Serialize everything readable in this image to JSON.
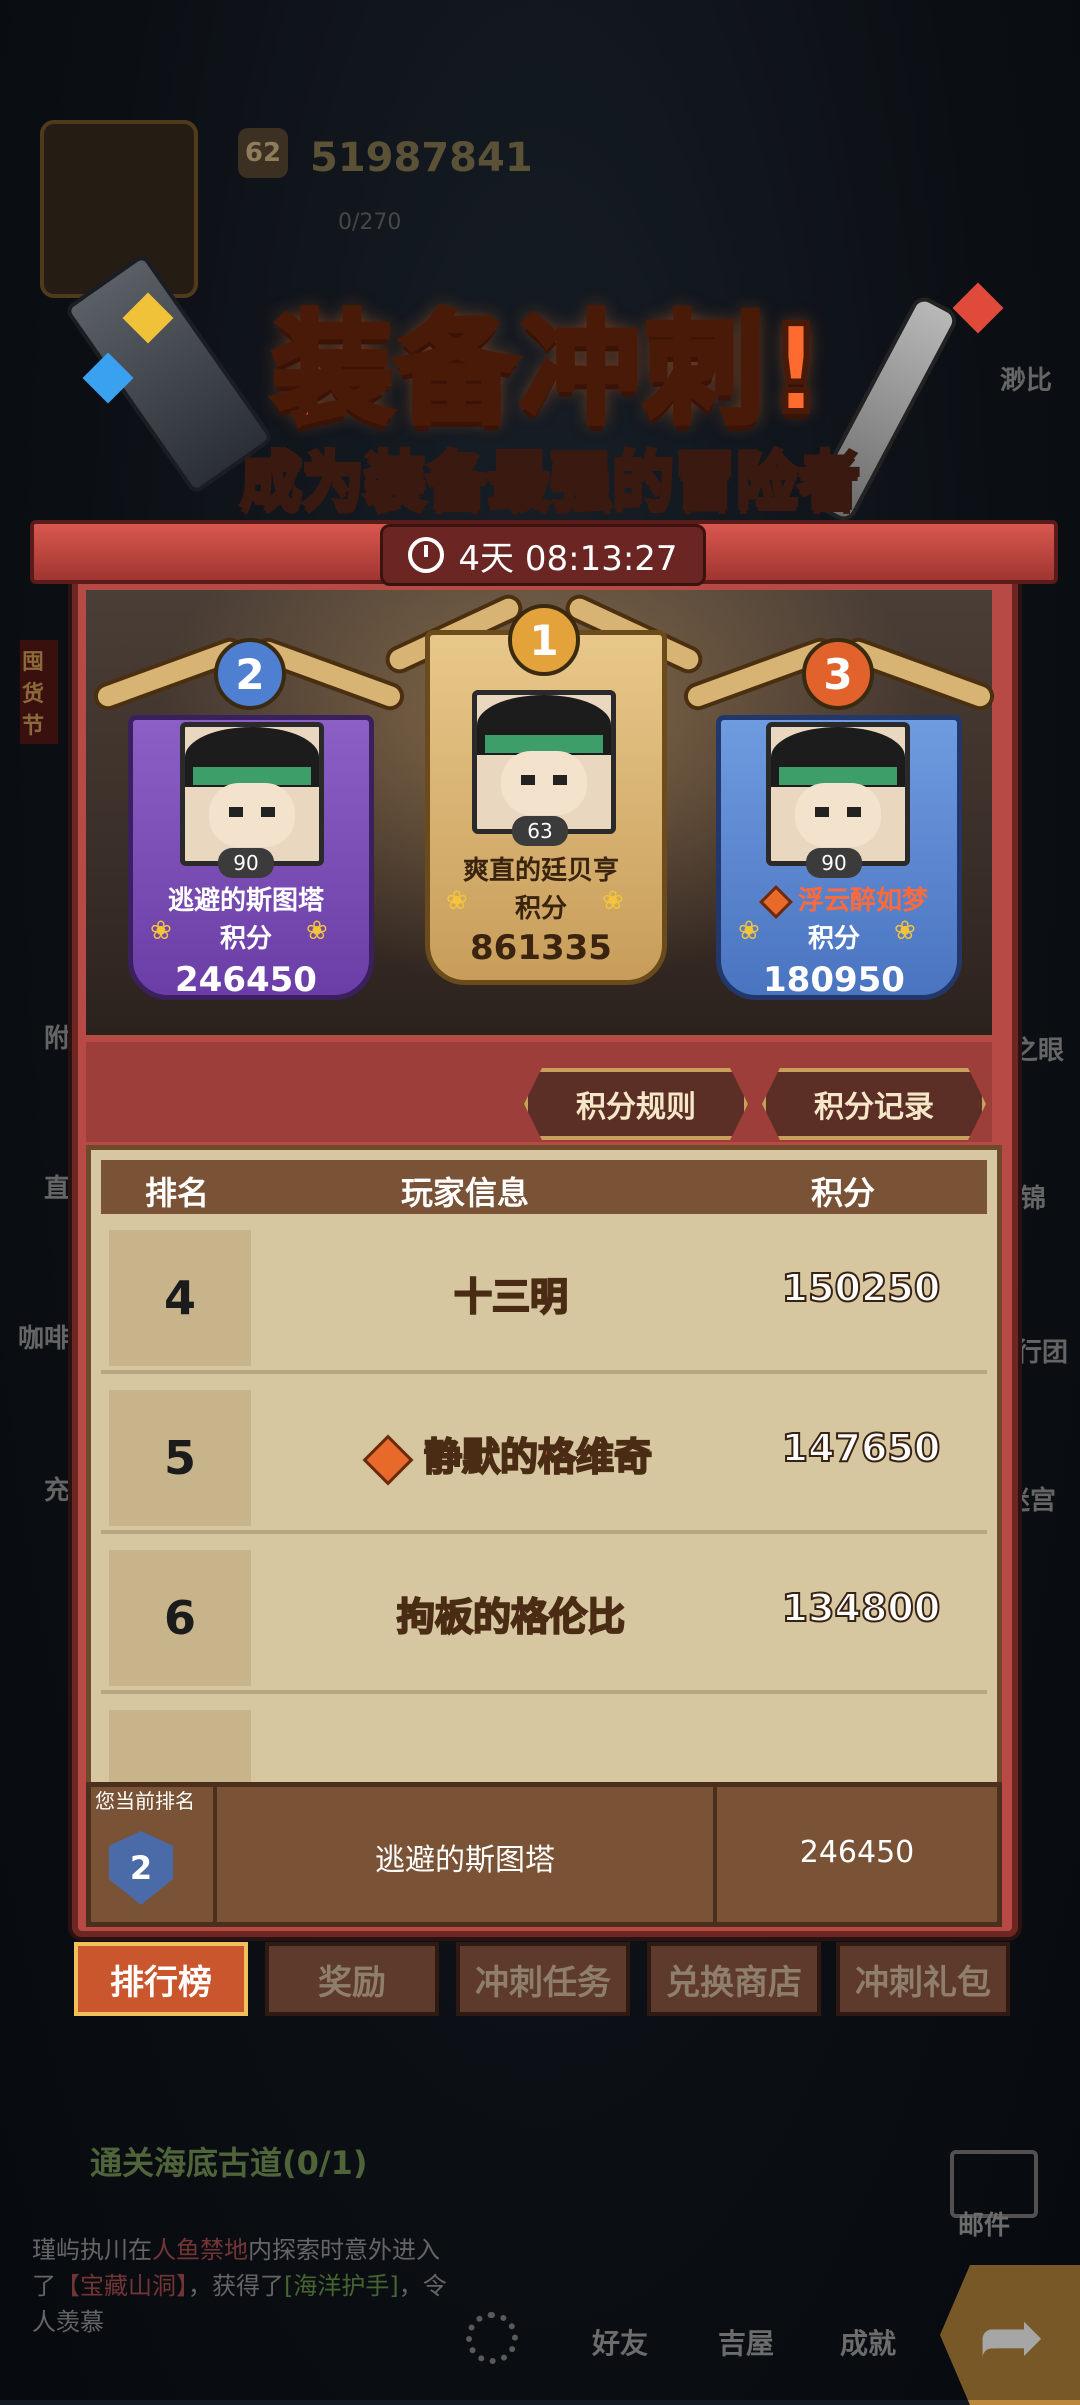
{
  "hud": {
    "level": "62",
    "gold": "51987841",
    "energy": "0/270"
  },
  "side_labels": {
    "right_1": "渺比",
    "right_2": "之眼",
    "right_3": "锦",
    "right_4": "行团",
    "right_5": "迷宫",
    "left_1": "附",
    "left_2": "直",
    "left_3": "咖啡",
    "left_4": "充",
    "left_badge": "囤货节"
  },
  "event": {
    "title": "装备冲刺!",
    "subtitle": "成为装备最强的冒险者",
    "timer": "4天 08:13:27"
  },
  "podium": [
    {
      "rank": "2",
      "level": "90",
      "name": "逃避的斯图塔",
      "label": "积分",
      "score": "246450"
    },
    {
      "rank": "1",
      "level": "63",
      "name": "爽直的廷贝亨",
      "label": "积分",
      "score": "861335"
    },
    {
      "rank": "3",
      "level": "90",
      "name": "浮云醉如梦",
      "label": "积分",
      "score": "180950"
    }
  ],
  "buttons": {
    "rules": "积分规则",
    "records": "积分记录"
  },
  "table": {
    "headers": {
      "rank": "排名",
      "player": "玩家信息",
      "score": "积分"
    },
    "rows": [
      {
        "rank": "4",
        "name": "十三明",
        "score": "150250"
      },
      {
        "rank": "5",
        "name": "静默的格维奇",
        "score": "147650"
      },
      {
        "rank": "6",
        "name": "拘板的格伦比",
        "score": "134800"
      }
    ]
  },
  "my_rank": {
    "label": "您当前排名",
    "rank": "2",
    "name": "逃避的斯图塔",
    "score": "246450"
  },
  "tabs": [
    "排行榜",
    "奖励",
    "冲刺任务",
    "兑换商店",
    "冲刺礼包"
  ],
  "quest": "通关海底古道(0/1)",
  "news": {
    "p1": "瑾屿执川在",
    "loc": "人鱼禁地",
    "p2": "内探索时意外进入了",
    "place": "【宝藏山洞】",
    "p3": "，获得了",
    "item": "[海洋护手]",
    "p4": "，令人羡慕"
  },
  "bottom_nav": {
    "friends": "好友",
    "house": "吉屋",
    "achievements": "成就",
    "mail": "邮件"
  },
  "colors": {
    "panel": "#b84a46",
    "active_tab": "#c9562c",
    "rank2": "#8b5fc4",
    "rank1": "#e8c88a",
    "rank3": "#6f9be0"
  }
}
